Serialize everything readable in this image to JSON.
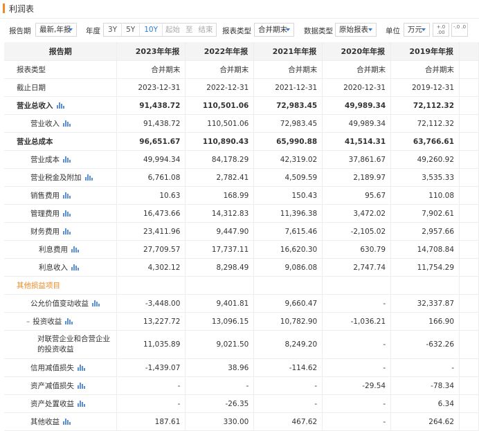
{
  "page_title": "利润表",
  "toolbar": {
    "report_period_label": "报告期",
    "report_period_value": "最新,年报",
    "year_label": "年度",
    "year_options": [
      "3Y",
      "5Y",
      "10Y"
    ],
    "year_selected": "10Y",
    "range_start": "起始",
    "range_to": "至",
    "range_end": "结束",
    "report_type_label": "报表类型",
    "report_type_value": "合并期末",
    "data_type_label": "数据类型",
    "data_type_value": "原始报表",
    "unit_label": "单位",
    "unit_value": "万元",
    "dec_inc": "+.0 .00",
    "dec_dec": "-.0 .0"
  },
  "table": {
    "header": [
      "报告期",
      "2023年年报",
      "2022年年报",
      "2021年年报",
      "2020年年报",
      "2019年年报"
    ],
    "rows": [
      {
        "label": "报表类型",
        "values": [
          "合并期末",
          "合并期末",
          "合并期末",
          "合并期末",
          "合并期末"
        ]
      },
      {
        "label": "截止日期",
        "values": [
          "2023-12-31",
          "2022-12-31",
          "2021-12-31",
          "2020-12-31",
          "2019-12-31"
        ]
      },
      {
        "label": "营业总收入",
        "values": [
          "91,438.72",
          "110,501.06",
          "72,983.45",
          "49,989.34",
          "72,112.32"
        ]
      },
      {
        "label": "营业收入",
        "values": [
          "91,438.72",
          "110,501.06",
          "72,983.45",
          "49,989.34",
          "72,112.32"
        ]
      },
      {
        "label": "营业总成本",
        "values": [
          "96,651.67",
          "110,890.43",
          "65,990.88",
          "41,514.31",
          "63,766.61"
        ]
      },
      {
        "label": "营业成本",
        "values": [
          "49,994.34",
          "84,178.29",
          "42,319.02",
          "37,861.67",
          "49,260.92"
        ]
      },
      {
        "label": "营业税金及附加",
        "values": [
          "6,761.08",
          "2,782.41",
          "4,509.59",
          "2,189.97",
          "3,535.33"
        ]
      },
      {
        "label": "销售费用",
        "values": [
          "10.63",
          "168.99",
          "150.43",
          "95.67",
          "110.08"
        ]
      },
      {
        "label": "管理费用",
        "values": [
          "16,473.66",
          "14,312.83",
          "11,396.38",
          "3,472.02",
          "7,902.61"
        ]
      },
      {
        "label": "财务费用",
        "values": [
          "23,411.96",
          "9,447.90",
          "7,615.46",
          "-2,105.02",
          "2,957.66"
        ]
      },
      {
        "label": "利息费用",
        "values": [
          "27,709.57",
          "17,737.11",
          "16,620.30",
          "630.79",
          "14,708.84"
        ]
      },
      {
        "label": "利息收入",
        "values": [
          "4,302.12",
          "8,298.49",
          "9,086.08",
          "2,747.74",
          "11,754.29"
        ]
      },
      {
        "label": "其他损益项目",
        "values": [
          "",
          "",
          "",
          "",
          ""
        ]
      },
      {
        "label": "公允价值变动收益",
        "values": [
          "-3,448.00",
          "9,401.81",
          "9,660.47",
          "-",
          "32,337.87"
        ]
      },
      {
        "label": "投资收益",
        "values": [
          "13,227.72",
          "13,096.15",
          "10,782.90",
          "-1,036.21",
          "166.90"
        ]
      },
      {
        "label": "对联营企业和合营企业的投资收益",
        "values": [
          "11,035.89",
          "9,021.50",
          "8,249.20",
          "-",
          "-632.26"
        ]
      },
      {
        "label": "信用减值损失",
        "values": [
          "-1,439.07",
          "38.96",
          "-114.62",
          "-",
          "-"
        ]
      },
      {
        "label": "资产减值损失",
        "values": [
          "-",
          "-",
          "-",
          "-29.54",
          "-78.34"
        ]
      },
      {
        "label": "资产处置收益",
        "values": [
          "-",
          "-26.35",
          "-",
          "-",
          "6.34"
        ]
      },
      {
        "label": "其他收益",
        "values": [
          "187.61",
          "330.00",
          "467.62",
          "-",
          "264.62"
        ]
      }
    ]
  },
  "icons": {
    "chart": "bar-chart-icon",
    "collapse": "minus-icon"
  },
  "colors": {
    "accent": "#f08a24",
    "link": "#2f7bd8",
    "header_bg": "#f4f4f4"
  }
}
